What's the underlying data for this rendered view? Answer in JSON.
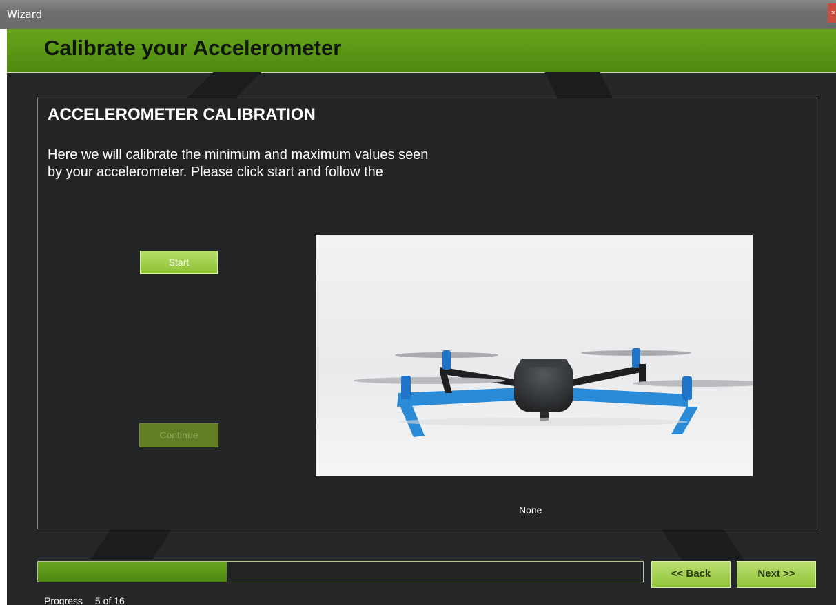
{
  "window": {
    "title": "Wizard",
    "close_glyph": "×"
  },
  "banner": {
    "heading": "Calibrate your Accelerometer"
  },
  "panel": {
    "title": "ACCELEROMETER CALIBRATION",
    "description_line1": "Here we will calibrate the minimum and maximum values seen",
    "description_line2": "by your accelerometer. Please click start and follow the",
    "start_label": "Start",
    "continue_label": "Continue",
    "status": "None"
  },
  "footer": {
    "back_label": "<< Back",
    "next_label": "Next >>",
    "progress_label": "Progress",
    "progress_value": "5 of 16",
    "progress_fraction": 0.3125
  },
  "colors": {
    "accent_green": "#5c9916",
    "button_green": "#9fcf4a",
    "background": "#252728"
  },
  "icons": {
    "close": "close-icon",
    "photo": "quadcopter-image"
  }
}
